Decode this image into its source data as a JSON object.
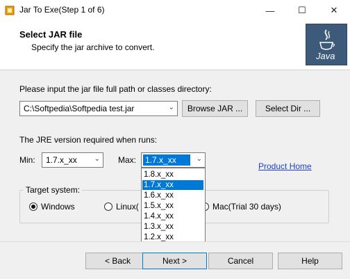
{
  "window": {
    "title": "Jar To Exe(Step 1 of 6)"
  },
  "header": {
    "title": "Select JAR file",
    "subtitle": "Specify the jar archive to convert.",
    "logo_text": "Java"
  },
  "jar": {
    "prompt": "Please input the jar file full path or classes directory:",
    "path_value": "C:\\Softpedia\\Softpedia test.jar",
    "browse_label": "Browse JAR ...",
    "select_dir_label": "Select Dir ..."
  },
  "jre": {
    "label": "The JRE version required when runs:",
    "min_label": "Min:",
    "min_value": "1.7.x_xx",
    "max_label": "Max:",
    "max_value": "1.7.x_xx",
    "options": [
      "1.8.x_xx",
      "1.7.x_xx",
      "1.6.x_xx",
      "1.5.x_xx",
      "1.4.x_xx",
      "1.3.x_xx",
      "1.2.x_xx"
    ],
    "selected_index": 1
  },
  "product_home": "Product Home",
  "target": {
    "legend": "Target system:",
    "windows": "Windows",
    "linux": "Linux(",
    "mac": "Mac(Trial 30 days)"
  },
  "footer": {
    "back": "< Back",
    "next": "Next >",
    "cancel": "Cancel",
    "help": "Help"
  },
  "icons": [
    "app-icon",
    "minimize-icon",
    "maximize-icon",
    "close-icon",
    "java-logo-icon",
    "chevron-down-icon"
  ],
  "colors": {
    "selection": "#0078d7",
    "link": "#1a3fd0"
  }
}
